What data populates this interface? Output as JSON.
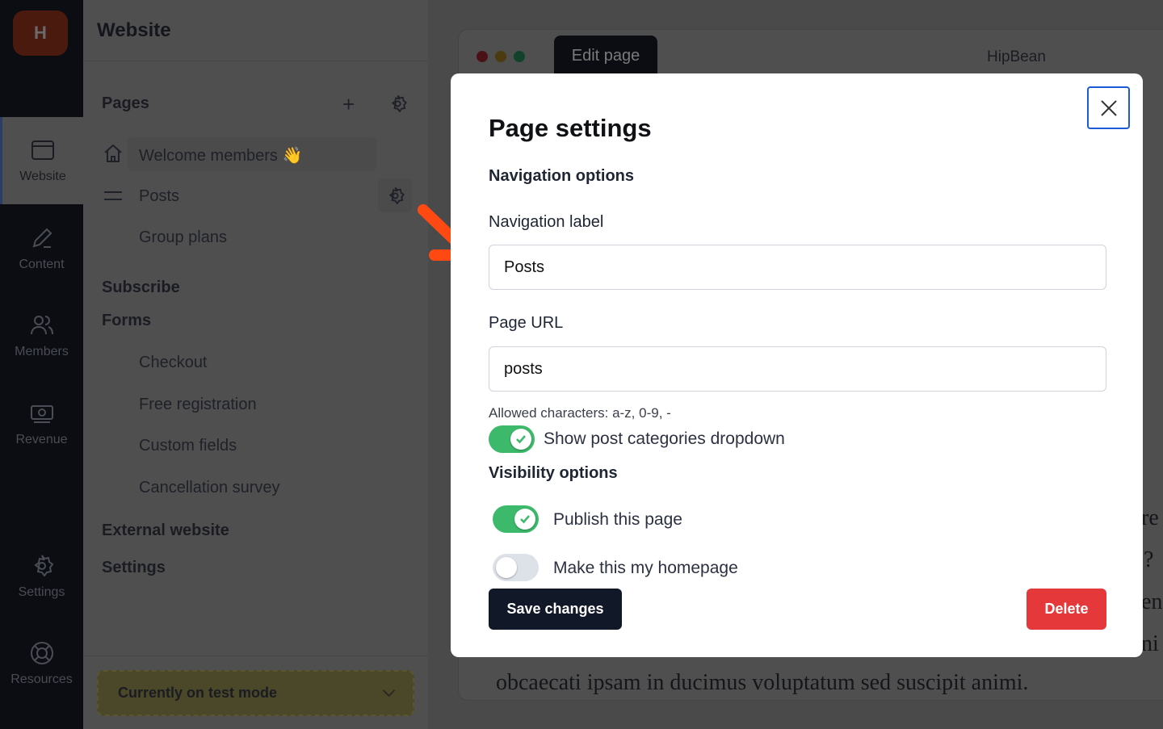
{
  "rail": {
    "logo": "H",
    "items": [
      {
        "label": "Website",
        "icon": "browser-window-icon"
      },
      {
        "label": "Content",
        "icon": "pencil-icon"
      },
      {
        "label": "Members",
        "icon": "users-icon"
      },
      {
        "label": "Revenue",
        "icon": "banknote-icon"
      },
      {
        "label": "Settings",
        "icon": "gear-icon"
      },
      {
        "label": "Resources",
        "icon": "lifebuoy-icon"
      }
    ]
  },
  "sidebar": {
    "title": "Website",
    "pages_heading": "Pages",
    "pages": [
      {
        "label": "Welcome members 👋",
        "icon": "home-icon"
      },
      {
        "label": "Posts",
        "icon": "drag-handle-icon"
      },
      {
        "label": "Group plans"
      }
    ],
    "subscribe": "Subscribe",
    "forms": "Forms",
    "form_items": [
      "Checkout",
      "Free registration",
      "Custom fields",
      "Cancellation survey"
    ],
    "external": "External website",
    "settings": "Settings",
    "test_mode": "Currently on test mode"
  },
  "preview": {
    "tab": "Edit page",
    "site_name": "HipBean",
    "fragments": [
      "re",
      "? ",
      "en",
      "ni"
    ],
    "bottom_line": "obcaecati ipsam in ducimus voluptatum sed suscipit animi."
  },
  "modal": {
    "title": "Page settings",
    "nav_heading": "Navigation options",
    "nav_label": "Navigation label",
    "nav_value": "Posts",
    "url_label": "Page URL",
    "url_value": "posts",
    "url_hint": "Allowed characters: a-z, 0-9, -",
    "show_categories": {
      "label": "Show post categories dropdown",
      "on": true
    },
    "vis_heading": "Visibility options",
    "publish": {
      "label": "Publish this page",
      "on": true
    },
    "homepage": {
      "label": "Make this my homepage",
      "on": false
    },
    "save": "Save changes",
    "delete": "Delete"
  },
  "colors": {
    "accent_green": "#3cb96a",
    "delete_red": "#e5383b",
    "save_dark": "#111827",
    "close_border": "#1d5ad6",
    "arrow": "#fe4a12"
  }
}
